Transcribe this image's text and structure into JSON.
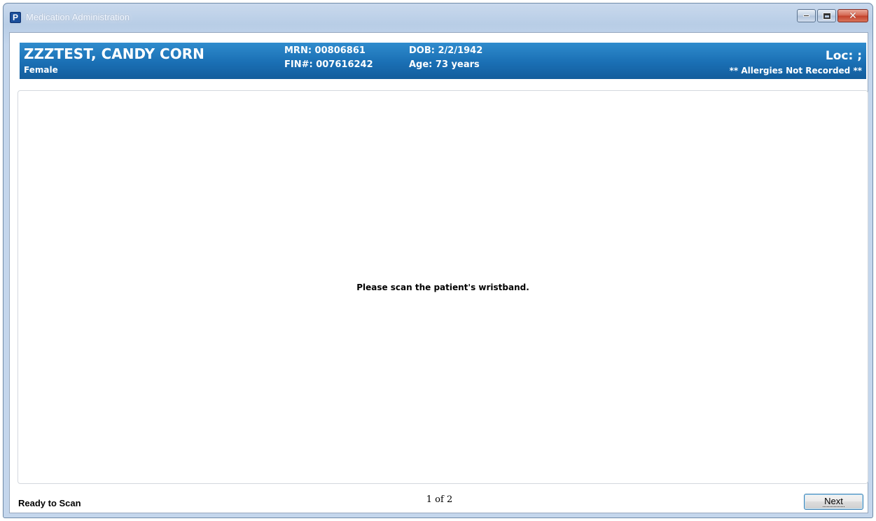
{
  "window": {
    "title": "Medication Administration",
    "app_icon_letter": "P"
  },
  "banner": {
    "patient_name": "ZZZTEST, CANDY CORN",
    "sex": "Female",
    "mrn": "MRN: 00806861",
    "fin": "FIN#: 007616242",
    "dob": "DOB: 2/2/1942",
    "age": "Age: 73 years",
    "location": "Loc: ;",
    "allergies": "** Allergies Not Recorded **"
  },
  "main": {
    "prompt": "Please scan the patient's wristband."
  },
  "footer": {
    "status": "Ready to Scan",
    "pager": "1 of 2",
    "next_label": "Next"
  },
  "colors": {
    "banner_top": "#2f8ccd",
    "banner_bottom": "#135d9c"
  }
}
